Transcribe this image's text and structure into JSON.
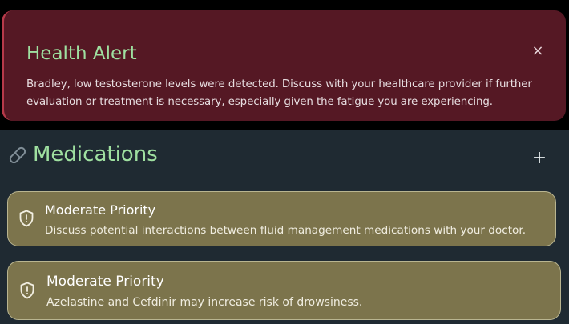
{
  "alert": {
    "title": "Health Alert",
    "close_glyph": "×",
    "message": "Bradley, low testosterone levels were detected. Discuss with your healthcare provider if further evaluation or treatment is necessary, especially given the fatigue you are experiencing.",
    "background_color": "#551824",
    "accent_color": "#b83a4a"
  },
  "medications": {
    "title": "Medications",
    "header_icon": "pill-icon",
    "add_glyph": "+",
    "title_color": "#9fe0a0",
    "cards": [
      {
        "icon": "shield-icon",
        "priority": "Moderate Priority",
        "text": "Discuss potential interactions between fluid management medications with your doctor."
      },
      {
        "icon": "shield-icon",
        "priority": "Moderate Priority",
        "text": "Azelastine and Cefdinir may increase risk of drowsiness."
      }
    ],
    "card_color": "#7c744c"
  }
}
